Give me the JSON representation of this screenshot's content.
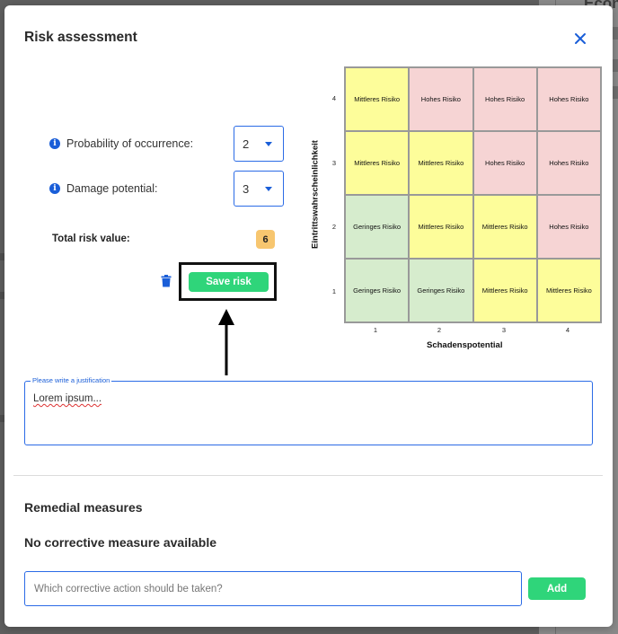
{
  "background": {
    "peek_text": "Econo"
  },
  "modal": {
    "title": "Risk assessment",
    "close_icon": "close-icon"
  },
  "fields": {
    "probability": {
      "label": "Probability of occurrence:",
      "value": "2",
      "icon": "info-icon"
    },
    "damage": {
      "label": "Damage potential:",
      "value": "3",
      "icon": "info-icon"
    }
  },
  "total": {
    "label": "Total risk value:",
    "value": "6"
  },
  "actions": {
    "save_label": "Save risk",
    "delete_icon": "trash-icon"
  },
  "matrix": {
    "y_label": "Eintrittswahrscheinlichkeit",
    "x_label": "Schadenspotential",
    "y_ticks": [
      "4",
      "3",
      "2",
      "1"
    ],
    "x_ticks": [
      "1",
      "2",
      "3",
      "4"
    ],
    "rows": [
      [
        {
          "text": "Mittleres Risiko",
          "level": "mid"
        },
        {
          "text": "Hohes Risiko",
          "level": "high"
        },
        {
          "text": "Hohes Risiko",
          "level": "high"
        },
        {
          "text": "Hohes Risiko",
          "level": "high"
        }
      ],
      [
        {
          "text": "Mittleres Risiko",
          "level": "mid"
        },
        {
          "text": "Mittleres Risiko",
          "level": "mid"
        },
        {
          "text": "Hohes Risiko",
          "level": "high"
        },
        {
          "text": "Hohes Risiko",
          "level": "high"
        }
      ],
      [
        {
          "text": "Geringes Risiko",
          "level": "low"
        },
        {
          "text": "Mittleres Risiko",
          "level": "mid"
        },
        {
          "text": "Mittleres Risiko",
          "level": "mid"
        },
        {
          "text": "Hohes Risiko",
          "level": "high"
        }
      ],
      [
        {
          "text": "Geringes Risiko",
          "level": "low"
        },
        {
          "text": "Geringes Risiko",
          "level": "low"
        },
        {
          "text": "Mittleres Risiko",
          "level": "mid"
        },
        {
          "text": "Mittleres Risiko",
          "level": "mid"
        }
      ]
    ],
    "colors": {
      "low": "#d6eccd",
      "mid": "#fdfd9a",
      "high": "#f6d4d4"
    }
  },
  "justification": {
    "legend": "Please write a justification",
    "value": "Lorem ipsum..."
  },
  "remedial": {
    "title": "Remedial measures",
    "empty_message": "No corrective measure available",
    "input_placeholder": "Which corrective action should be taken?",
    "add_label": "Add"
  },
  "colors": {
    "accent": "#1a5ed8",
    "primary_button": "#2fd57a",
    "badge": "#f7c66f"
  }
}
